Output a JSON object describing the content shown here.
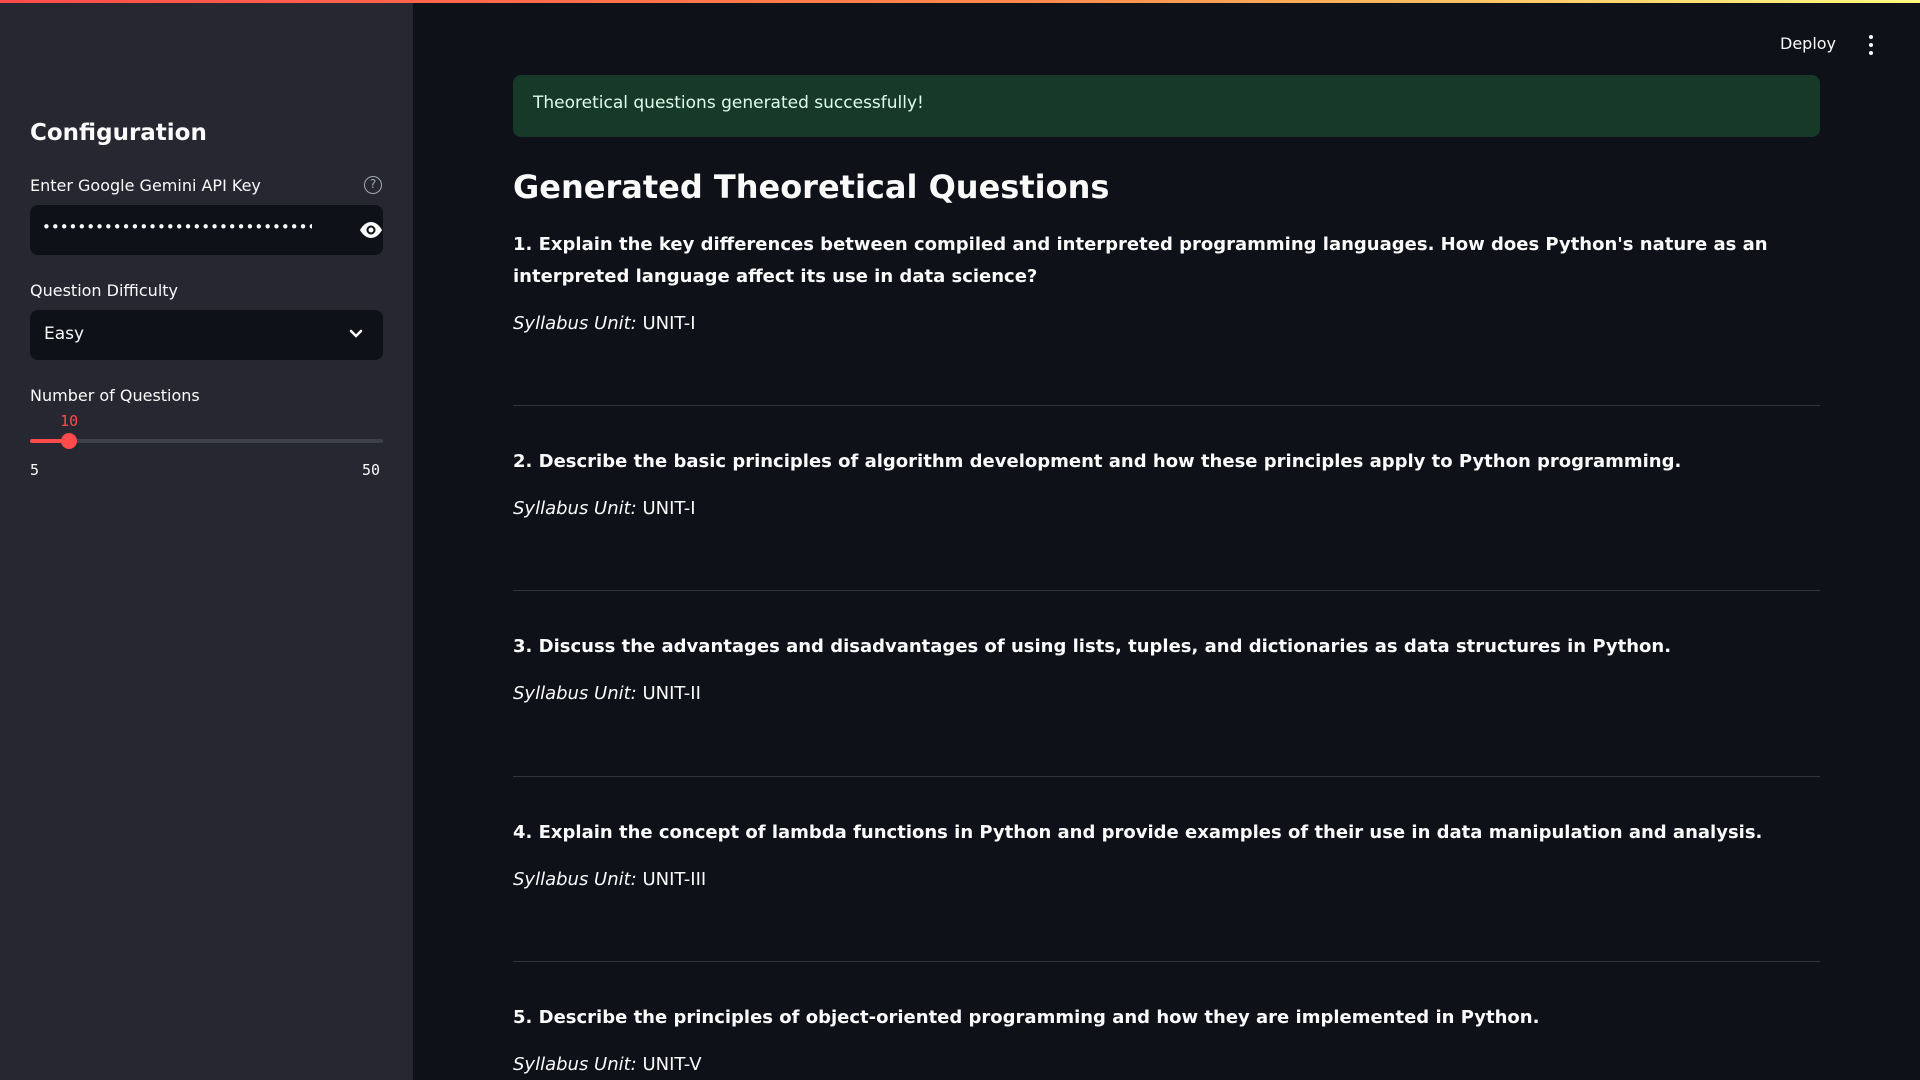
{
  "sidebar": {
    "title": "Configuration",
    "api_key": {
      "label": "Enter Google Gemini API Key",
      "help": "?",
      "masked_value": "•••••••••••••••••••••••••••••••••••••••"
    },
    "difficulty": {
      "label": "Question Difficulty",
      "value": "Easy"
    },
    "num_questions": {
      "label": "Number of Questions",
      "value": "10",
      "min": "5",
      "max": "50",
      "fraction": 0.111
    }
  },
  "header": {
    "deploy_label": "Deploy"
  },
  "main": {
    "success_message": "Theoretical questions generated successfully!",
    "title": "Generated Theoretical Questions",
    "unit_label": "Syllabus Unit:",
    "questions": [
      {
        "text": "1. Explain the key differences between compiled and interpreted programming languages. How does Python's nature as an interpreted language affect its use in data science?",
        "unit": "UNIT-I"
      },
      {
        "text": "2. Describe the basic principles of algorithm development and how these principles apply to Python programming.",
        "unit": "UNIT-I"
      },
      {
        "text": "3. Discuss the advantages and disadvantages of using lists, tuples, and dictionaries as data structures in Python.",
        "unit": "UNIT-II"
      },
      {
        "text": "4. Explain the concept of lambda functions in Python and provide examples of their use in data manipulation and analysis.",
        "unit": "UNIT-III"
      },
      {
        "text": "5. Describe the principles of object-oriented programming and how they are implemented in Python.",
        "unit": "UNIT-V"
      }
    ]
  },
  "colors": {
    "accent": "#ff4b4b",
    "sidebar_bg": "#262730",
    "main_bg": "#0e1117",
    "success_bg": "#173928"
  }
}
